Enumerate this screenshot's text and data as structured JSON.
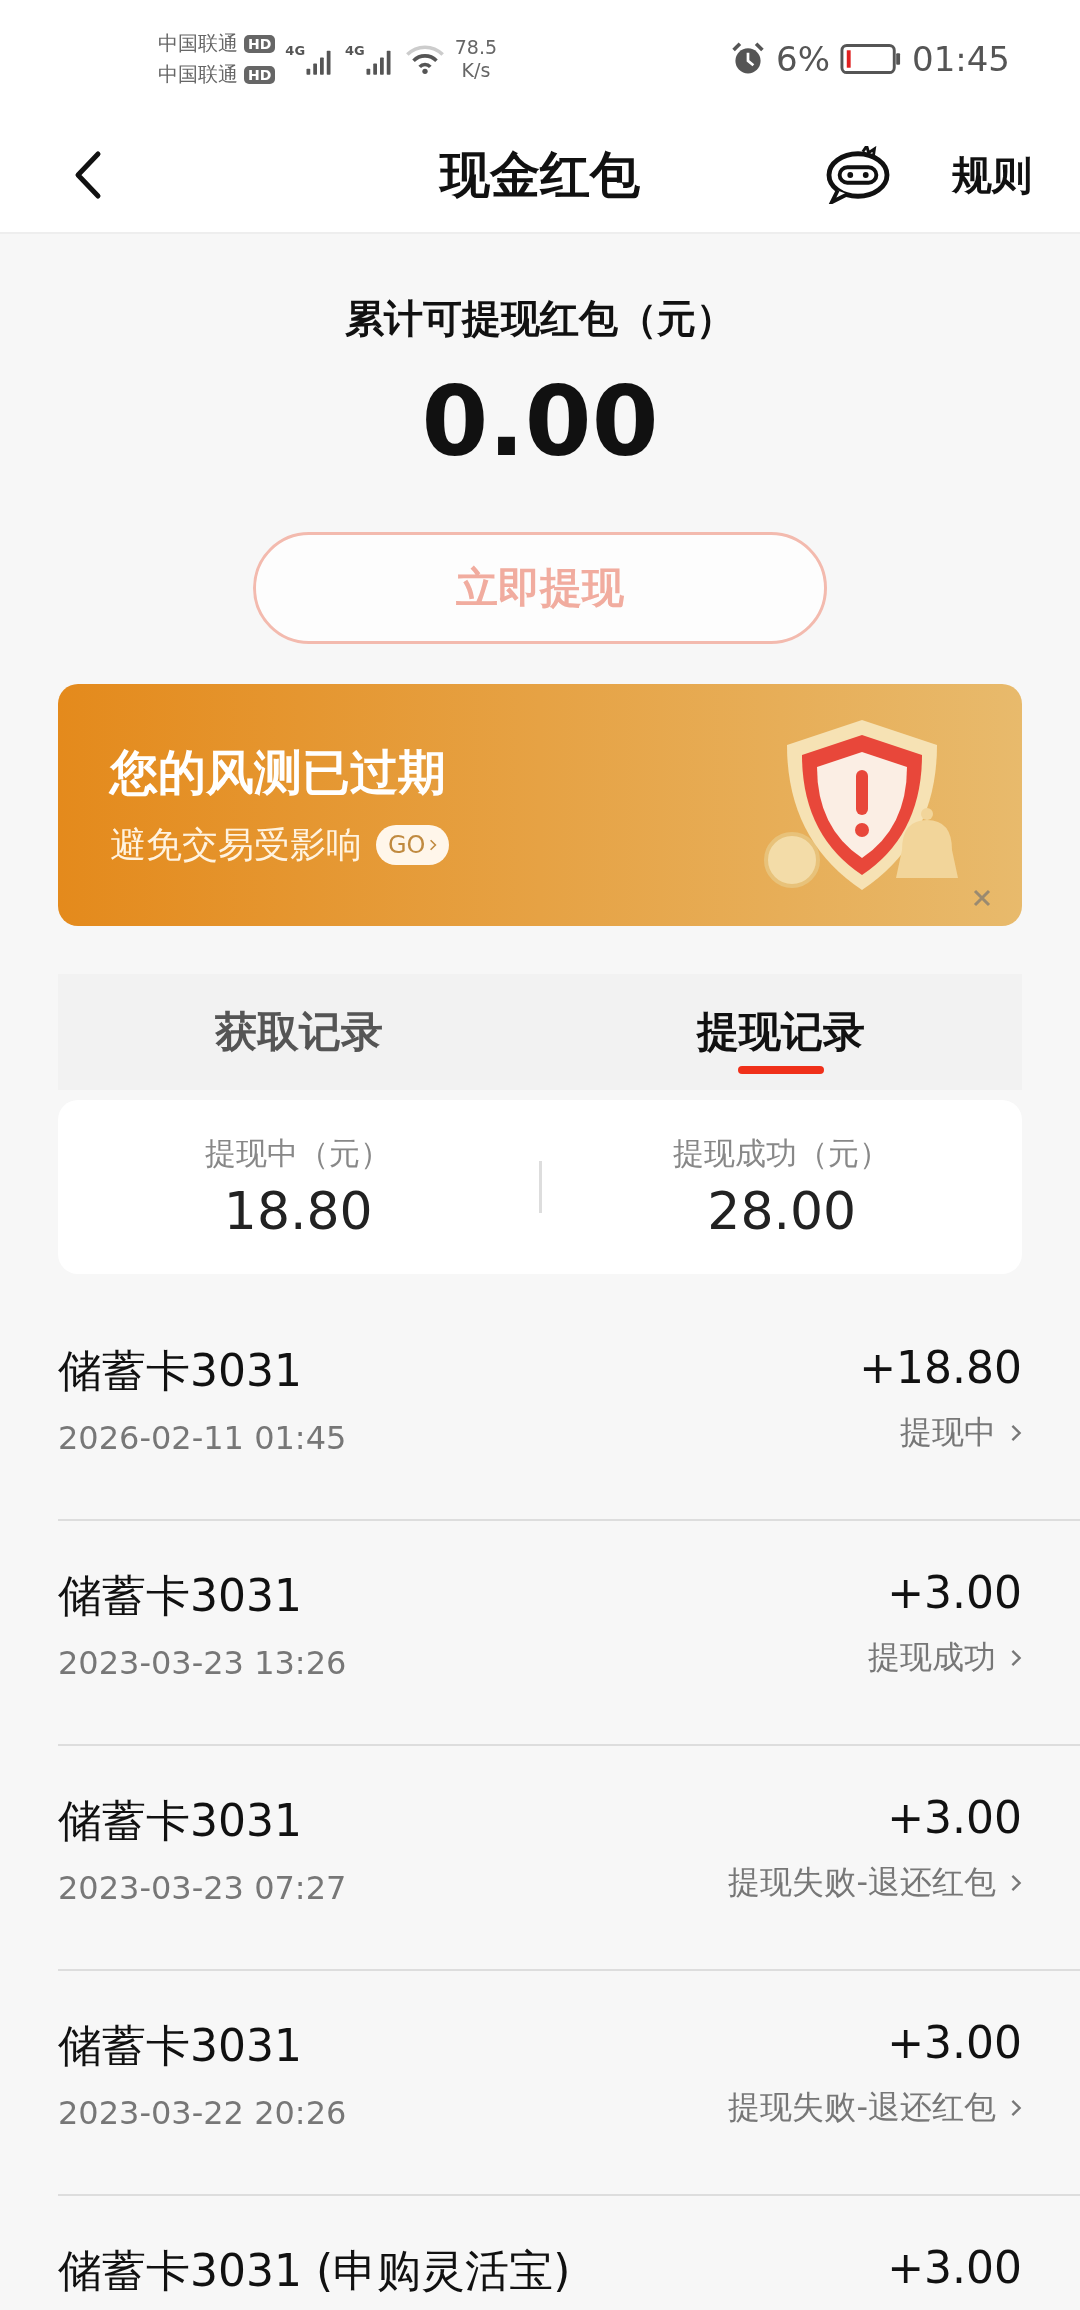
{
  "status_bar": {
    "carriers": [
      "中国联通",
      "中国联通"
    ],
    "hd_badges": [
      "HD",
      "HD"
    ],
    "network_types": [
      "4G",
      "4G"
    ],
    "speed_value": "78.5",
    "speed_unit": "K/s",
    "battery_percent": "6%",
    "time": "01:45"
  },
  "header": {
    "title": "现金红包",
    "rules_link": "规则"
  },
  "balance": {
    "label": "累计可提现红包（元）",
    "amount": "0.00",
    "withdraw_button": "立即提现",
    "withdraw_disabled": true
  },
  "banner": {
    "title": "您的风测已过期",
    "subtitle": "避免交易受影响",
    "go_button": "GO"
  },
  "tabs": [
    {
      "label": "获取记录",
      "selected": false
    },
    {
      "label": "提现记录",
      "selected": true
    }
  ],
  "summary": [
    {
      "label": "提现中（元）",
      "value": "18.80"
    },
    {
      "label": "提现成功（元）",
      "value": "28.00"
    }
  ],
  "records": [
    {
      "title": "储蓄卡3031",
      "date": "2026-02-11 01:45",
      "amount": "+18.80",
      "status": "提现中"
    },
    {
      "title": "储蓄卡3031",
      "date": "2023-03-23 13:26",
      "amount": "+3.00",
      "status": "提现成功"
    },
    {
      "title": "储蓄卡3031",
      "date": "2023-03-23 07:27",
      "amount": "+3.00",
      "status": "提现失败-退还红包"
    },
    {
      "title": "储蓄卡3031",
      "date": "2023-03-22 20:26",
      "amount": "+3.00",
      "status": "提现失败-退还红包"
    },
    {
      "title": "储蓄卡3031 (申购灵活宝)",
      "amount": "+3.00"
    }
  ]
}
